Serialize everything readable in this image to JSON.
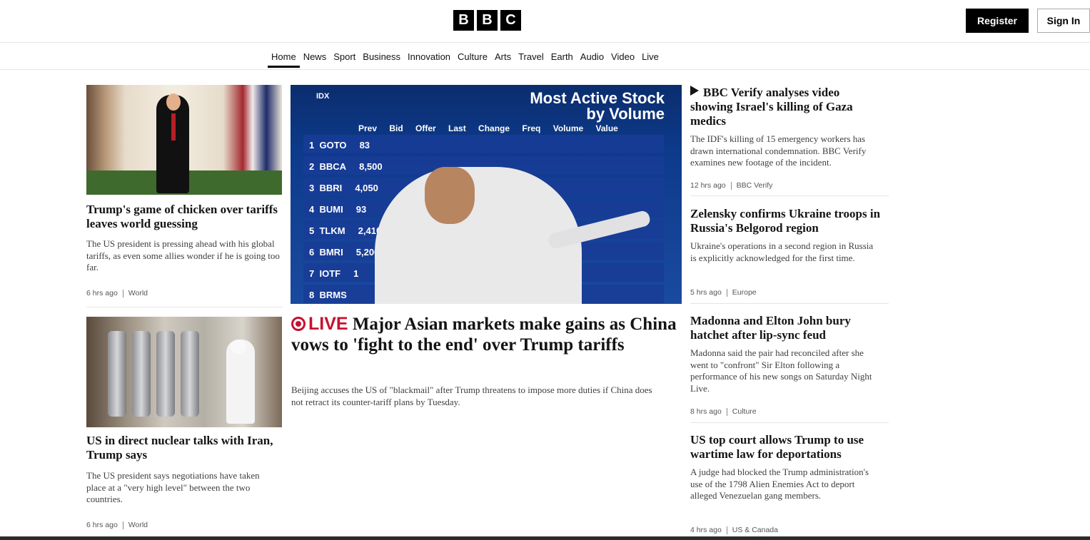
{
  "header": {
    "logo_letters": [
      "B",
      "B",
      "C"
    ],
    "register_label": "Register",
    "signin_label": "Sign In"
  },
  "nav": {
    "items": [
      "Home",
      "News",
      "Sport",
      "Business",
      "Innovation",
      "Culture",
      "Arts",
      "Travel",
      "Earth",
      "Audio",
      "Video",
      "Live"
    ],
    "active": "Home"
  },
  "left_column": {
    "story1": {
      "headline": "Trump's game of chicken over tariffs leaves world guessing",
      "summary": "The US president is pressing ahead with his global tariffs, as even some allies wonder if he is going too far.",
      "time": "6 hrs ago",
      "section": "World"
    },
    "story2": {
      "headline": "US in direct nuclear talks with Iran, Trump says",
      "summary": "The US president says negotiations have taken place at a \"very high level\" between the two countries.",
      "time": "6 hrs ago",
      "section": "World"
    }
  },
  "center_column": {
    "image_text": {
      "exchange": "IDX",
      "board_title_line1": "Most Active Stock",
      "board_title_line2": "by Volume",
      "columns": "Prev Bid Offer Last Change Freq Volume Value",
      "rows": [
        {
          "n": "1",
          "code": "GOTO",
          "prev": "83"
        },
        {
          "n": "2",
          "code": "BBCA",
          "prev": "8,500"
        },
        {
          "n": "3",
          "code": "BBRI",
          "prev": "4,050"
        },
        {
          "n": "4",
          "code": "BUMI",
          "prev": "93"
        },
        {
          "n": "5",
          "code": "TLKM",
          "prev": "2,410"
        },
        {
          "n": "6",
          "code": "BMRI",
          "prev": "5,200"
        },
        {
          "n": "7",
          "code": "IOTF",
          "prev": "1"
        },
        {
          "n": "8",
          "code": "BRMS",
          "prev": ""
        }
      ]
    },
    "live_label": "LIVE",
    "headline": "Major Asian markets make gains as China vows to 'fight to the end' over Trump tariffs",
    "summary": "Beijing accuses the US of \"blackmail\" after Trump threatens to impose more duties if China does not retract its counter-tariff plans by Tuesday."
  },
  "right_column": {
    "story1": {
      "headline": "BBC Verify analyses video showing Israel's killing of Gaza medics",
      "summary": "The IDF's killing of 15 emergency workers has drawn international condemnation. BBC Verify examines new footage of the incident.",
      "time": "12 hrs ago",
      "section": "BBC Verify"
    },
    "story2": {
      "headline": "Zelensky confirms Ukraine troops in Russia's Belgorod region",
      "summary": "Ukraine's operations in a second region in Russia is explicitly acknowledged for the first time.",
      "time": "5 hrs ago",
      "section": "Europe"
    },
    "story3": {
      "headline": "Madonna and Elton John bury hatchet after lip-sync feud",
      "summary": "Madonna said the pair had reconciled after she went to \"confront\" Sir Elton following a performance of his new songs on Saturday Night Live.",
      "time": "8 hrs ago",
      "section": "Culture"
    },
    "story4": {
      "headline": "US top court allows Trump to use wartime law for deportations",
      "summary": "A judge had blocked the Trump administration's use of the 1798 Alien Enemies Act to deport alleged Venezuelan gang members.",
      "time": "4 hrs ago",
      "section": "US & Canada"
    }
  },
  "colors": {
    "live_red": "#c8102e",
    "text": "#141414",
    "meta": "#545658"
  }
}
